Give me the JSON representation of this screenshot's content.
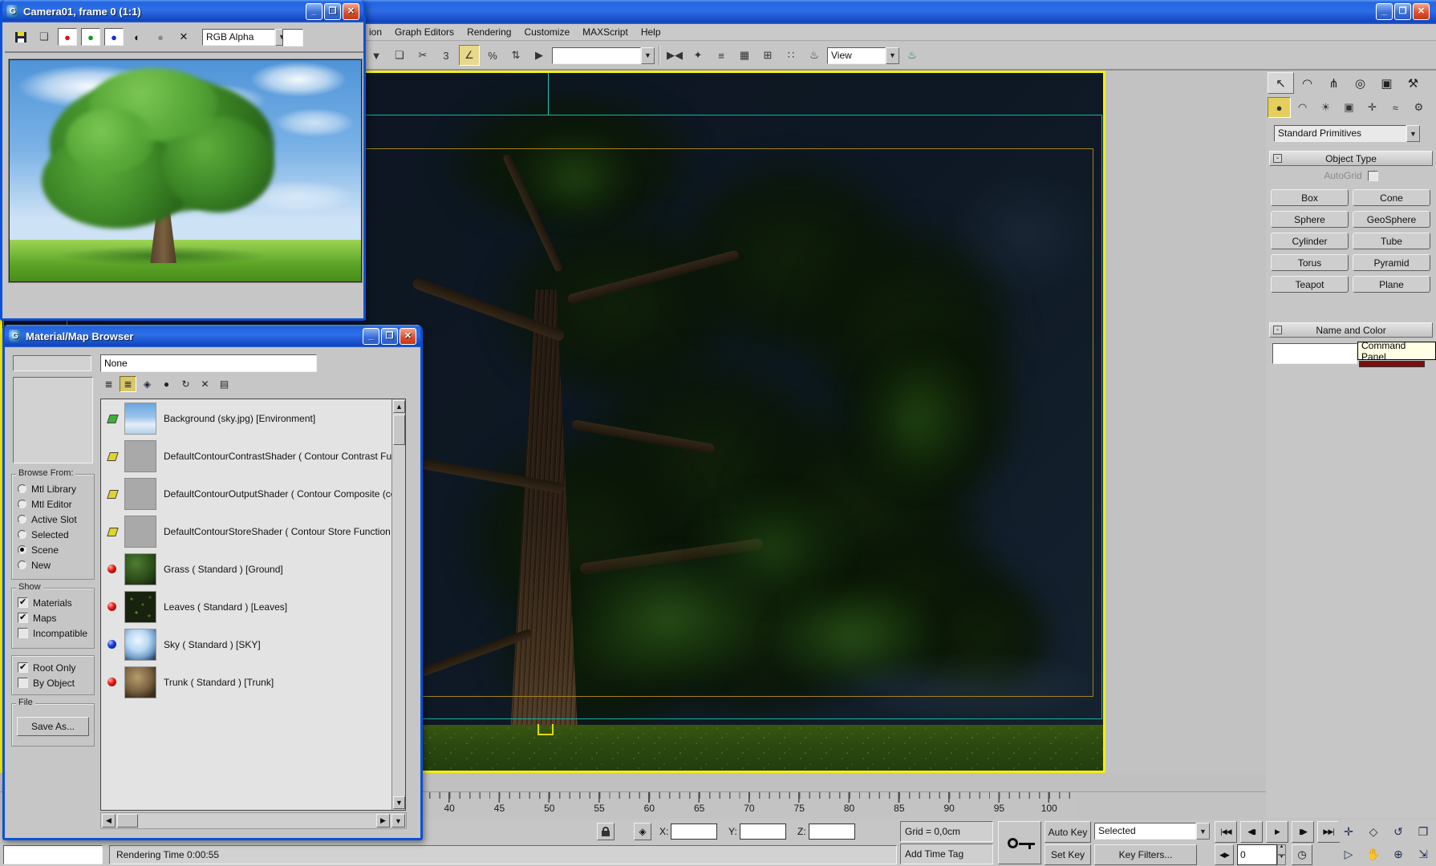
{
  "main_window": {
    "buttons": [
      {
        "name": "minimize-button",
        "glyph": "_",
        "kind": "min"
      },
      {
        "name": "restore-button",
        "glyph": "❐",
        "kind": "max"
      },
      {
        "name": "close-button",
        "glyph": "✕",
        "kind": "close"
      }
    ]
  },
  "menu_bar": {
    "items": [
      "ion",
      "Graph Editors",
      "Rendering",
      "Customize",
      "MAXScript",
      "Help"
    ]
  },
  "main_toolbar": {
    "left_icons": [
      {
        "name": "flyout-arrow-icon",
        "glyph": "▼",
        "state": ""
      },
      {
        "name": "named-selection-sets-icon",
        "glyph": "❏",
        "state": ""
      },
      {
        "name": "unlink-icon",
        "glyph": "✂",
        "state": ""
      },
      {
        "name": "snap-toggle-3d-icon",
        "glyph": "3",
        "state": ""
      },
      {
        "name": "angle-snap-toggle-icon",
        "glyph": "∠",
        "state": "on"
      },
      {
        "name": "percent-snap-toggle-icon",
        "glyph": "%",
        "state": ""
      },
      {
        "name": "spinner-snap-toggle-icon",
        "glyph": "⇅",
        "state": ""
      },
      {
        "name": "select-by-name-icon",
        "glyph": "▶",
        "state": ""
      }
    ],
    "named_selection_value": "",
    "right_icons": [
      {
        "name": "mirror-icon",
        "glyph": "▶◀",
        "state": ""
      },
      {
        "name": "align-icon",
        "glyph": "✦",
        "state": ""
      },
      {
        "name": "layer-manager-icon",
        "glyph": "≡",
        "state": ""
      },
      {
        "name": "curve-editor-icon",
        "glyph": "▦",
        "state": ""
      },
      {
        "name": "schematic-view-icon",
        "glyph": "⊞",
        "state": ""
      },
      {
        "name": "material-editor-icon",
        "glyph": "∷",
        "state": ""
      },
      {
        "name": "render-scene-icon",
        "glyph": "♨",
        "state": ""
      }
    ],
    "view_dropdown": "View"
  },
  "camera_window": {
    "title": "Camera01, frame 0 (1:1)",
    "icons": [
      {
        "name": "save-image-icon",
        "glyph": "",
        "kind": "disk"
      },
      {
        "name": "clone-rendered-frame-icon",
        "glyph": "❏",
        "kind": "clone"
      },
      {
        "name": "red-channel-icon",
        "glyph": "●",
        "kind": "chan red"
      },
      {
        "name": "green-channel-icon",
        "glyph": "●",
        "kind": "chan green"
      },
      {
        "name": "blue-channel-icon",
        "glyph": "●",
        "kind": "chan blue"
      },
      {
        "name": "monochrome-icon",
        "glyph": "◐",
        "kind": "mono"
      },
      {
        "name": "alpha-channel-icon",
        "glyph": "●",
        "kind": "gray"
      },
      {
        "name": "clear-icon",
        "glyph": "✕",
        "kind": "clear"
      }
    ],
    "channel_dropdown": "RGB Alpha"
  },
  "material_browser": {
    "title": "Material/Map Browser",
    "name_field": "None",
    "toolbar": [
      {
        "name": "view-list-icon",
        "glyph": "≣",
        "state": ""
      },
      {
        "name": "view-list-plus-icons-icon",
        "glyph": "≣",
        "state": "on"
      },
      {
        "name": "view-small-icons-icon",
        "glyph": "◈",
        "state": ""
      },
      {
        "name": "view-large-icons-icon",
        "glyph": "●",
        "state": ""
      },
      {
        "name": "update-scene-materials-icon",
        "glyph": "↻",
        "state": ""
      },
      {
        "name": "delete-from-library-icon",
        "glyph": "✕",
        "state": ""
      },
      {
        "name": "clear-material-library-icon",
        "glyph": "▤",
        "state": ""
      }
    ],
    "entries": [
      {
        "label": "Background (sky.jpg)  [Environment]",
        "type_icon": "map-green",
        "thumb": "sky"
      },
      {
        "label": "DefaultContourContrastShader  ( Contour Contrast Function",
        "type_icon": "map-yellow",
        "thumb": "flat"
      },
      {
        "label": "DefaultContourOutputShader  ( Contour Composite (contour",
        "type_icon": "map-yellow",
        "thumb": "flat"
      },
      {
        "label": "DefaultContourStoreShader  ( Contour Store Function (cont",
        "type_icon": "map-yellow",
        "thumb": "flat"
      },
      {
        "label": "Grass  ( Standard ) [Ground]",
        "type_icon": "mat-red",
        "thumb": "grass"
      },
      {
        "label": "Leaves  ( Standard ) [Leaves]",
        "type_icon": "mat-red",
        "thumb": "leaves"
      },
      {
        "label": "Sky  ( Standard ) [SKY]",
        "type_icon": "mat-blue",
        "thumb": "skyball"
      },
      {
        "label": "Trunk  ( Standard ) [Trunk]",
        "type_icon": "mat-red",
        "thumb": "bark"
      }
    ],
    "browse_from": {
      "label": "Browse From:",
      "options": [
        {
          "label": "Mtl Library",
          "state": ""
        },
        {
          "label": "Mtl Editor",
          "state": ""
        },
        {
          "label": "Active Slot",
          "state": ""
        },
        {
          "label": "Selected",
          "state": ""
        },
        {
          "label": "Scene",
          "state": "on"
        },
        {
          "label": "New",
          "state": ""
        }
      ]
    },
    "show": {
      "label": "Show",
      "options": [
        {
          "label": "Materials",
          "state": "on"
        },
        {
          "label": "Maps",
          "state": "on"
        },
        {
          "label": "Incompatible",
          "state": ""
        }
      ]
    },
    "show2": {
      "options": [
        {
          "label": "Root Only",
          "state": "on"
        },
        {
          "label": "By Object",
          "state": ""
        }
      ]
    },
    "file": {
      "label": "File",
      "save_as": "Save As..."
    }
  },
  "command_panel": {
    "tabs": [
      {
        "name": "create-tab",
        "glyph": "↖",
        "state": "on"
      },
      {
        "name": "modify-tab",
        "glyph": "◠",
        "state": ""
      },
      {
        "name": "hierarchy-tab",
        "glyph": "⋔",
        "state": ""
      },
      {
        "name": "motion-tab",
        "glyph": "◎",
        "state": ""
      },
      {
        "name": "display-tab",
        "glyph": "▣",
        "state": ""
      },
      {
        "name": "utilities-tab",
        "glyph": "⚒",
        "state": ""
      }
    ],
    "categories": [
      {
        "name": "geometry-category",
        "glyph": "●",
        "state": "on"
      },
      {
        "name": "shapes-category",
        "glyph": "◠",
        "state": ""
      },
      {
        "name": "lights-category",
        "glyph": "☀",
        "state": ""
      },
      {
        "name": "cameras-category",
        "glyph": "▣",
        "state": ""
      },
      {
        "name": "helpers-category",
        "glyph": "✛",
        "state": ""
      },
      {
        "name": "space-warps-category",
        "glyph": "≈",
        "state": ""
      },
      {
        "name": "systems-category",
        "glyph": "⚙",
        "state": ""
      }
    ],
    "dropdown": "Standard Primitives",
    "object_type": {
      "header": "Object Type",
      "autogrid": "AutoGrid",
      "buttons": [
        "Box",
        "Cone",
        "Sphere",
        "GeoSphere",
        "Cylinder",
        "Tube",
        "Torus",
        "Pyramid",
        "Teapot",
        "Plane"
      ]
    },
    "name_and_color": {
      "header": "Name and Color",
      "name_value": ""
    },
    "tooltip": "Command Panel"
  },
  "timeline": {
    "labels": [
      "40",
      "45",
      "50",
      "55",
      "60",
      "65",
      "70",
      "75",
      "80",
      "85",
      "90",
      "95",
      "100"
    ]
  },
  "playback": [
    {
      "name": "go-to-start-button",
      "glyph": "|◀◀"
    },
    {
      "name": "previous-frame-button",
      "glyph": "◀▮"
    },
    {
      "name": "play-button",
      "glyph": "▶"
    },
    {
      "name": "next-frame-button",
      "glyph": "▮▶"
    },
    {
      "name": "go-to-end-button",
      "glyph": "▶▶|"
    }
  ],
  "viewport_nav": [
    {
      "name": "zoom-extents-selected-icon",
      "glyph": "✛"
    },
    {
      "name": "zoom-extents-all-icon",
      "glyph": "◇"
    },
    {
      "name": "zoom-region-icon",
      "glyph": "↺"
    },
    {
      "name": "min-max-toggle-icon",
      "glyph": "❐"
    },
    {
      "name": "field-of-view-icon",
      "glyph": "▷"
    },
    {
      "name": "pan-icon",
      "glyph": "✋"
    },
    {
      "name": "arc-rotate-icon",
      "glyph": "⊕"
    },
    {
      "name": "maximize-viewport-icon",
      "glyph": "⇲"
    }
  ],
  "status": {
    "x_label": "X:",
    "y_label": "Y:",
    "z_label": "Z:",
    "x_value": "",
    "y_value": "",
    "z_value": "",
    "grid": "Grid = 0,0cm",
    "add_time_tag": "Add Time Tag",
    "rendering_time": "Rendering Time  0:00:55",
    "auto_key": "Auto Key",
    "set_key": "Set Key",
    "selected_filter": "Selected",
    "key_filters": "Key Filters...",
    "frame_number": "0",
    "key_step_glyph": "◀▶",
    "time_config_glyph": "◷"
  },
  "colors": {
    "xp_title_blue": "#2365e0",
    "viewport_border_yellow": "#f4ef0e",
    "safe_frame_cyan": "#17b3a3",
    "safe_frame_orange": "#a8811e",
    "ui_gray": "#c6c6c6"
  }
}
